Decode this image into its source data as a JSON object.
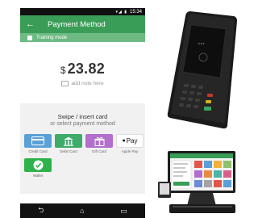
{
  "status_bar": {
    "time": "15:34"
  },
  "app_bar": {
    "back_icon": "arrow-left-icon",
    "title": "Payment Method"
  },
  "training_mode": {
    "label": "Training mode"
  },
  "amount": {
    "currency": "$",
    "value": "23.82"
  },
  "note": {
    "icon": "note-icon",
    "label": "add note here"
  },
  "instructions": {
    "line1": "Swipe / insert card",
    "line2": "or select payment method"
  },
  "payment_methods": [
    {
      "label": "Credit Card",
      "icon": "credit-card-icon",
      "color": "#5a9fd6"
    },
    {
      "label": "Debit Card",
      "icon": "debit-card-icon",
      "color": "#3dab6a"
    },
    {
      "label": "Gift Card",
      "icon": "gift-card-icon",
      "color": "#b26fcb"
    },
    {
      "label": "Apple Pay",
      "icon": "apple-pay-icon",
      "color": "#111111",
      "mark": "Pay"
    },
    {
      "label": "Wallet",
      "icon": "wallet-check-icon",
      "color": "#2eb24a"
    }
  ],
  "colors": {
    "primary": "#3a9d57",
    "training": "#6dbb83",
    "panel": "#f1f1f1"
  }
}
